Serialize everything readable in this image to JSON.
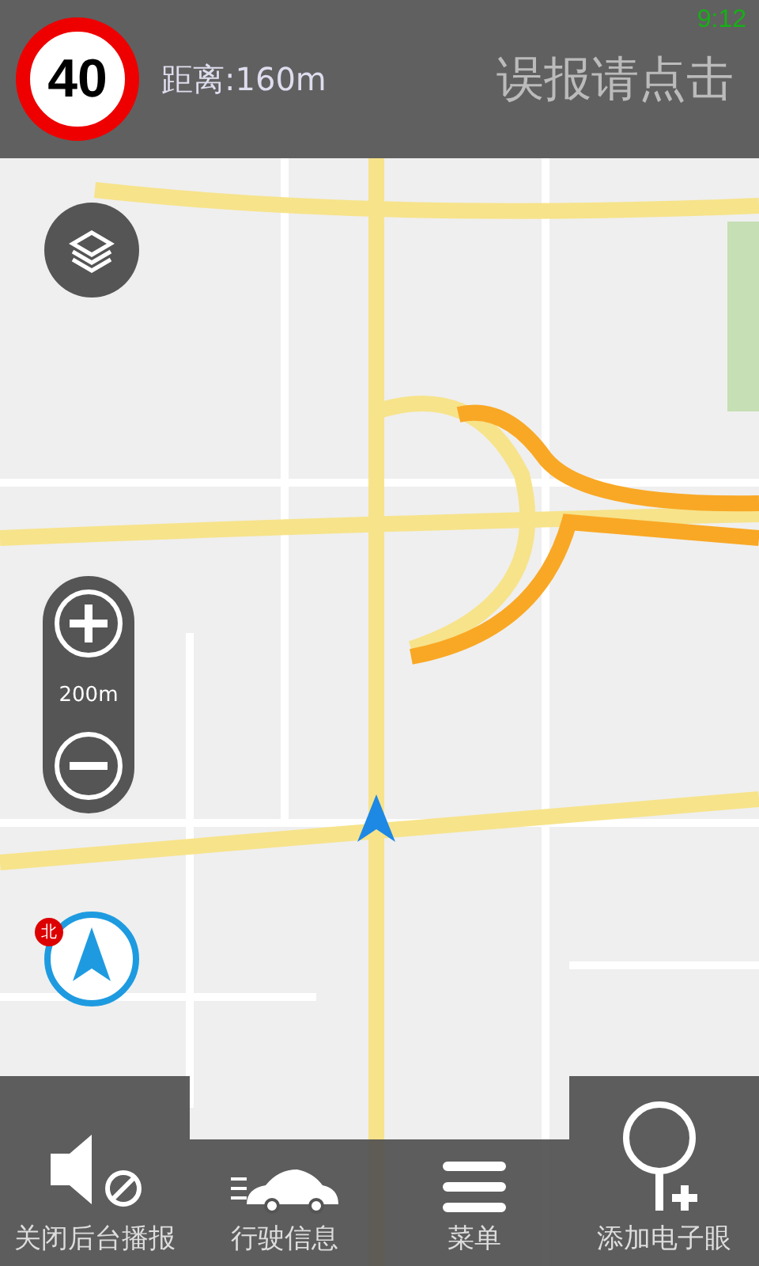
{
  "status_bar": {
    "time": "9:12"
  },
  "top_bar": {
    "speed_limit": "40",
    "distance": "距离:160m",
    "report_button": "误报请点击"
  },
  "zoom_control": {
    "scale": "200m"
  },
  "compass": {
    "north_label": "北"
  },
  "bottom_bar": [
    {
      "kind": "mute",
      "label": "关闭后台播报"
    },
    {
      "kind": "car",
      "label": "行驶信息"
    },
    {
      "kind": "menu",
      "label": "菜单"
    },
    {
      "kind": "add-camera",
      "label": "添加电子眼"
    }
  ]
}
